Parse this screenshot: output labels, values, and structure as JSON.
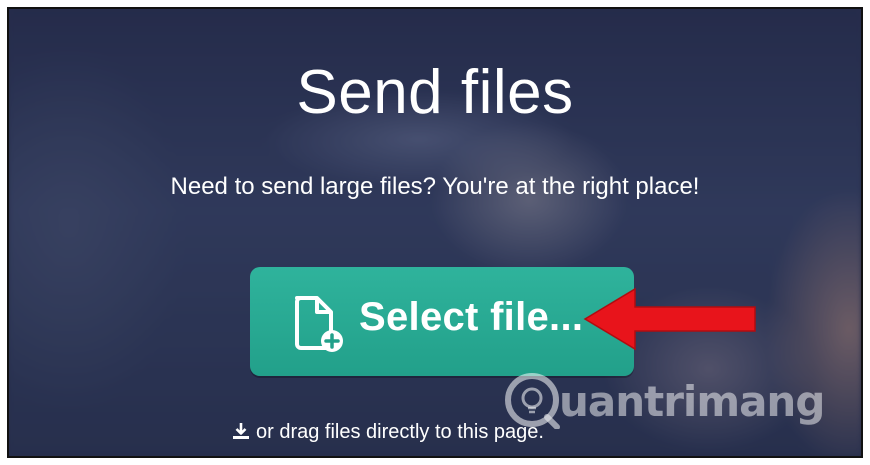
{
  "page": {
    "title": "Send files",
    "subtitle": "Need to send large files? You're at the right place!"
  },
  "select_button": {
    "label": "Select file...",
    "icon": "file-add-icon",
    "color": "#22a08a"
  },
  "drag_hint": {
    "icon": "download-icon",
    "text": "or drag files directly to this page."
  },
  "annotation": {
    "arrow_color": "#e8141b"
  },
  "watermark": {
    "text": "uantrimang"
  }
}
